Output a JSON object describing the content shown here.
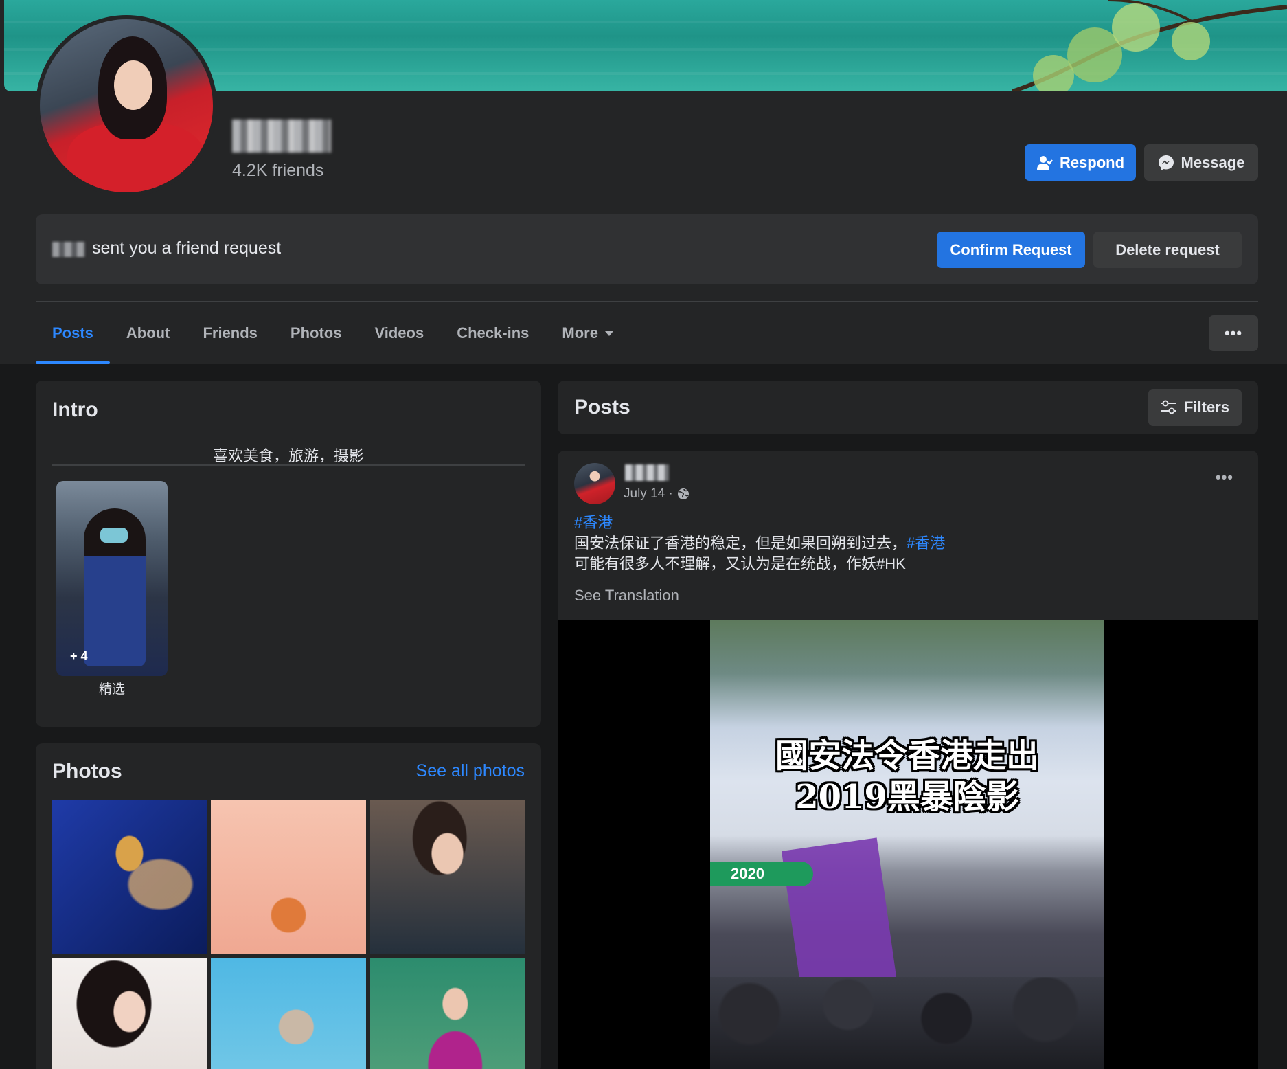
{
  "profile": {
    "friends_count": "4.2K friends",
    "respond_label": "Respond",
    "message_label": "Message"
  },
  "friend_request": {
    "text": "sent you a friend request",
    "confirm_label": "Confirm Request",
    "delete_label": "Delete request"
  },
  "tabs": [
    {
      "label": "Posts",
      "active": true
    },
    {
      "label": "About"
    },
    {
      "label": "Friends"
    },
    {
      "label": "Photos"
    },
    {
      "label": "Videos"
    },
    {
      "label": "Check-ins"
    },
    {
      "label": "More"
    }
  ],
  "more_menu_label": "•••",
  "intro": {
    "title": "Intro",
    "bio": "喜欢美食，旅游，摄影",
    "featured": {
      "count": "+ 4",
      "label": "精选"
    }
  },
  "photos": {
    "title": "Photos",
    "see_all": "See all photos"
  },
  "posts_section": {
    "title": "Posts",
    "filters_label": "Filters"
  },
  "post": {
    "date": "July 14 ·",
    "menu_label": "•••",
    "line1_hashtag": "#香港",
    "line2_text": "国安法保证了香港的稳定，但是如果回朔到过去，",
    "line2_hashtag": "#香港",
    "line3_text": "可能有很多人不理解，又认为是在统战，作妖#HK",
    "see_translation": "See Translation",
    "video": {
      "title_line1": "國安法令香港走出",
      "title_line2": "2019黑暴陰影",
      "year_tag": "2020"
    }
  },
  "colors": {
    "accent": "#2d88ff",
    "button_blue": "#2374e1",
    "card_bg": "#242526",
    "page_bg": "#18191a"
  },
  "icons": [
    "respond-person-icon",
    "messenger-icon",
    "caret-down-icon",
    "globe-icon",
    "filters-icon",
    "more-dots-icon"
  ]
}
